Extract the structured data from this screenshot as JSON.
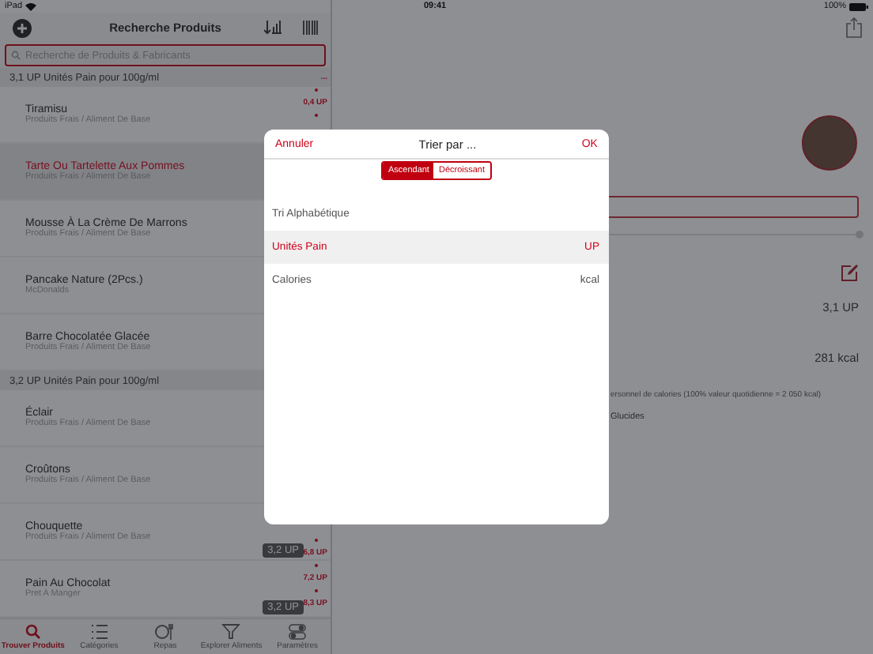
{
  "status_bar": {
    "device": "iPad",
    "time": "09:41",
    "battery": "100%"
  },
  "sidebar": {
    "title": "Recherche Produits",
    "search": {
      "placeholder": "Recherche de Produits & Fabricants"
    },
    "sections": [
      {
        "header": "3,1 UP Unités Pain pour 100g/ml",
        "rows": [
          {
            "name": "Tiramisu",
            "category": "Produits Frais / Aliment De Base",
            "selected": false
          },
          {
            "name": "Tarte Ou Tartelette Aux Pommes",
            "category": "Produits Frais / Aliment De Base",
            "selected": true
          },
          {
            "name": "Mousse À La Crème De Marrons",
            "category": "Produits Frais / Aliment De Base",
            "selected": false
          },
          {
            "name": "Pancake Nature (2Pcs.)",
            "category": "McDonalds",
            "selected": false
          },
          {
            "name": "Barre Chocolatée Glacée",
            "category": "Produits Frais / Aliment De Base",
            "selected": false
          }
        ]
      },
      {
        "header": "3,2 UP Unités Pain pour 100g/ml",
        "rows": [
          {
            "name": "Éclair",
            "category": "Produits Frais / Aliment De Base",
            "selected": false
          },
          {
            "name": "Croûtons",
            "category": "Produits Frais / Aliment De Base",
            "selected": false
          },
          {
            "name": "Chouquette",
            "category": "Produits Frais / Aliment De Base",
            "selected": false,
            "badge": "3,2 UP"
          },
          {
            "name": "Pain Au Chocolat",
            "category": "Pret A Manger",
            "selected": false,
            "badge": "3,2 UP"
          }
        ]
      }
    ],
    "index_top": [
      {
        "kind": "label",
        "text": "..."
      },
      {
        "kind": "dot"
      },
      {
        "kind": "label",
        "text": "0,4 UP"
      },
      {
        "kind": "dot"
      }
    ],
    "index_bottom": [
      {
        "kind": "dot"
      },
      {
        "kind": "label",
        "text": "6,8 UP"
      },
      {
        "kind": "dot"
      },
      {
        "kind": "label",
        "text": "7,2 UP"
      },
      {
        "kind": "dot"
      },
      {
        "kind": "label",
        "text": "8,3 UP"
      }
    ]
  },
  "tab_bar": [
    {
      "label": "Trouver Produits",
      "selected": true
    },
    {
      "label": "Catégories",
      "selected": false
    },
    {
      "label": "Repas",
      "selected": false
    },
    {
      "label": "Explorer Aliments",
      "selected": false
    },
    {
      "label": "Paramètres",
      "selected": false
    }
  ],
  "detail": {
    "gauges": [
      {
        "value": "3,1 UP"
      },
      {
        "value": "281 kcal"
      }
    ],
    "note": "ersonnel de calories (100% valeur quotidienne = 2 050 kcal)",
    "nutrient": "Glucides"
  },
  "dialog": {
    "cancel": "Annuler",
    "title": "Trier par ...",
    "confirm": "OK",
    "order": [
      {
        "label": "Ascendant",
        "selected": true
      },
      {
        "label": "Décroissant",
        "selected": false
      }
    ],
    "options": [
      {
        "label": "Tri Alphabétique",
        "selected": false
      },
      {
        "label": "Unités Pain",
        "unit": "UP",
        "selected": true
      },
      {
        "label": "Calories",
        "unit": "kcal",
        "selected": false
      }
    ]
  }
}
